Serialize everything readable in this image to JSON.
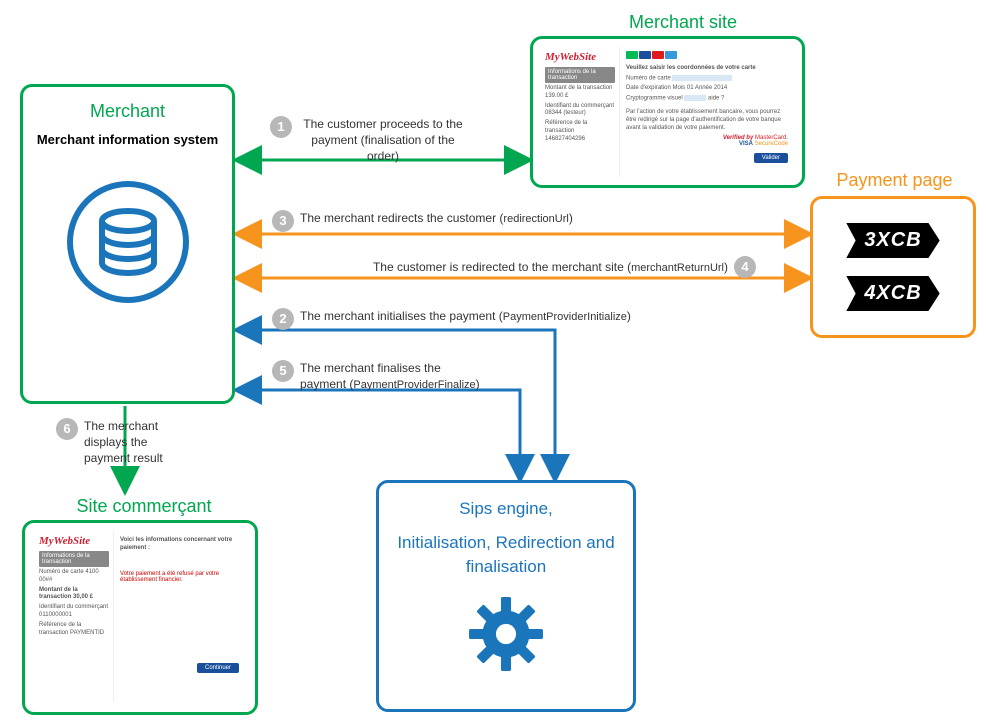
{
  "nodes": {
    "merchant": {
      "title": "Merchant",
      "subtitle": "Merchant information system"
    },
    "merchant_site": {
      "title": "Merchant site",
      "brand": "MyWebSite",
      "sidebar_header": "Informations de la transaction",
      "sidebar": [
        "Montant de la transaction 139.00 £",
        "Identifiant du commerçant 08344 (testeur)",
        "Référence de la transaction 146827404296"
      ],
      "form_title": "Veuillez saisir les coordonnées de votre carte",
      "fields": [
        {
          "label": "Numéro de carte",
          "value": ""
        },
        {
          "label": "Date d'expiration",
          "value": "Mois 01  Année 2014"
        },
        {
          "label": "Cryptogramme visuel",
          "value": "aide ?"
        }
      ],
      "notice": "Par l'action de votre établissement bancaire, vous pourrez être redirigé sur la page d'authentification de votre banque avant la validation de votre paiement.",
      "logos": [
        "Verified by Visa",
        "MasterCard.",
        "VISA",
        "SecureCode"
      ],
      "button": "Valider"
    },
    "payment_page": {
      "title": "Payment page",
      "chips": [
        "3XCB",
        "4XCB"
      ]
    },
    "sips": {
      "line1": "Sips engine,",
      "line2": "Initialisation, Redirection and finalisation"
    },
    "site_commercant": {
      "title": "Site commerçant",
      "brand": "MyWebSite",
      "sidebar_header": "Informations de la transaction",
      "heading": "Voici les informations concernant votre paiement :",
      "sidebar": [
        "Numéro de carte 4100 00##",
        "Montant de la transaction 30,00 £",
        "Identifiant du commerçant 0110000001",
        "Référence de la transaction PAYMENTID"
      ],
      "message": "Votre paiement a été refusé par votre établissement financier.",
      "button": "Continuer"
    }
  },
  "steps": {
    "s1": {
      "n": "1",
      "text": "The customer proceeds to the payment (finalisation of the order)"
    },
    "s2": {
      "n": "2",
      "text": "The merchant initialises the payment (",
      "code": "PaymentProviderInitialize",
      "after": ")"
    },
    "s3": {
      "n": "3",
      "text": "The merchant redirects the customer (",
      "code": "redirectionUrl",
      "after": ")"
    },
    "s4": {
      "n": "4",
      "text": "The customer is redirected to the merchant site (",
      "code": "merchantReturnUrl",
      "after": ")"
    },
    "s5": {
      "n": "5",
      "text": "The merchant finalises the payment (",
      "code": "PaymentProviderFinalize",
      "after": ")"
    },
    "s6": {
      "n": "6",
      "text": "The merchant displays the payment result"
    }
  },
  "colors": {
    "green": "#00a650",
    "orange": "#f7941d",
    "blue": "#1b75bb",
    "gray": "#b7b7b7"
  }
}
